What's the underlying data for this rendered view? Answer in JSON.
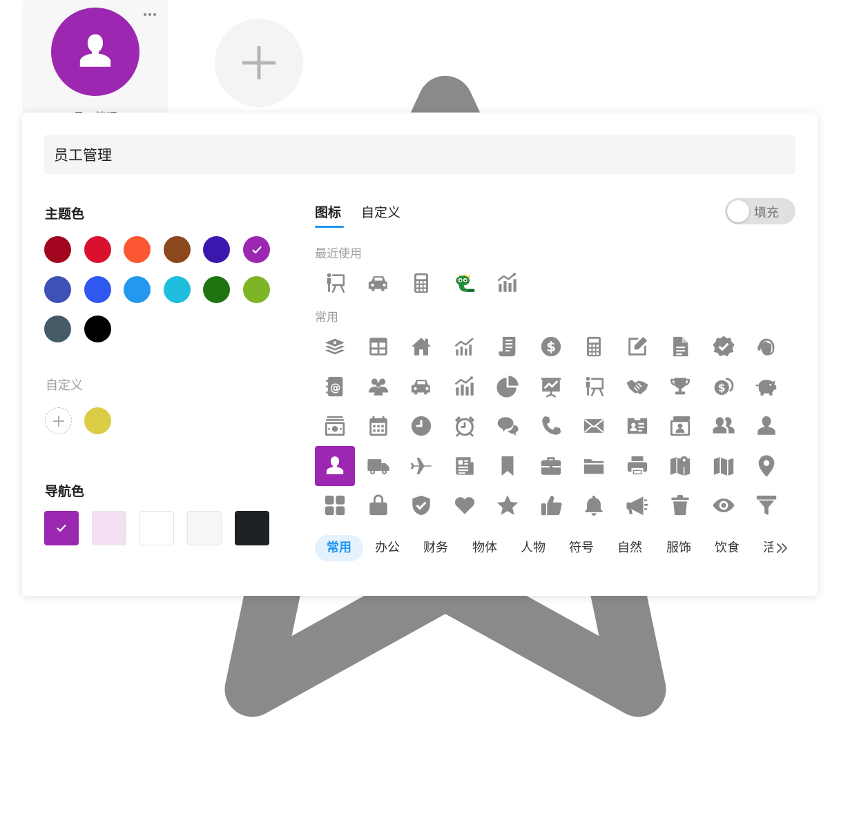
{
  "app": {
    "name": "员工管理",
    "accent": "#9c27b0"
  },
  "panel": {
    "name_value": "员工管理",
    "theme": {
      "title": "主题色",
      "colors": [
        "#a1061e",
        "#d9112f",
        "#fa5732",
        "#8b481d",
        "#3b18ad",
        "#9c27b0",
        "#3e51b4",
        "#2e58f0",
        "#2498ee",
        "#1fbedd",
        "#207410",
        "#7eb527",
        "#465b68",
        "#000000"
      ],
      "selected_index": 5,
      "custom_title": "自定义",
      "custom_colors": [
        "#dbcc45"
      ]
    },
    "nav": {
      "title": "导航色",
      "colors": [
        "#9c27b0",
        "#f3e0f2",
        "#ffffff",
        "#f5f6f7",
        "#1e2126"
      ],
      "selected_index": 0
    },
    "tabs": [
      {
        "label": "图标",
        "active": true
      },
      {
        "label": "自定义",
        "active": false
      }
    ],
    "fill_toggle": {
      "label": "填充",
      "on": false
    },
    "recent_title": "最近使用",
    "common_title": "常用",
    "recent_icons": [
      "presentation-icon",
      "car-icon",
      "calculator-icon",
      "snake-mascot-icon",
      "bar-chart-icon"
    ],
    "common_icons": [
      "layers-icon",
      "table-icon",
      "home-icon",
      "growth-chart-icon",
      "receipt-icon",
      "dollar-icon",
      "calculator-icon",
      "edit-note-icon",
      "document-icon",
      "verified-badge-icon",
      "support-agent-icon",
      "contacts-book-icon",
      "group-icon",
      "car-icon",
      "bar-chart-icon",
      "pie-chart-icon",
      "presentation-board-icon",
      "presentation-icon",
      "handshake-icon",
      "trophy-icon",
      "coins-icon",
      "piggy-bank-icon",
      "cash-icon",
      "calendar-icon",
      "clock-icon",
      "alarm-icon",
      "chat-icon",
      "phone-icon",
      "mail-icon",
      "id-card-icon",
      "contact-folder-icon",
      "people-icon",
      "person-icon",
      "user-icon",
      "truck-icon",
      "airplane-icon",
      "newspaper-icon",
      "bookmark-icon",
      "briefcase-icon",
      "folder-icon",
      "printer-icon",
      "map-pin-icon",
      "map-icon",
      "location-icon",
      "grid-icon",
      "shopping-bag-icon",
      "shield-icon",
      "heart-icon",
      "star-icon",
      "thumbs-up-icon",
      "bell-icon",
      "megaphone-icon",
      "trash-icon",
      "eye-icon",
      "filter-icon"
    ],
    "selected_common_index": 33,
    "categories": [
      "常用",
      "办公",
      "财务",
      "物体",
      "人物",
      "符号",
      "自然",
      "服饰",
      "饮食",
      "活动"
    ],
    "active_category_index": 0
  },
  "colors": {
    "icon_gray": "#8a8a8a",
    "tab_accent": "#2196f3"
  }
}
